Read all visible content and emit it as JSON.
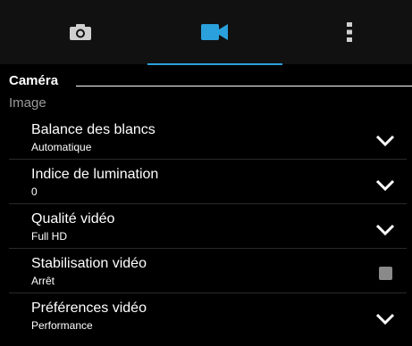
{
  "tabs": [
    {
      "icon": "camera-icon",
      "active": false
    },
    {
      "icon": "video-camera-icon",
      "active": true
    },
    {
      "icon": "more-vert-icon",
      "active": false
    }
  ],
  "colors": {
    "accent": "#2aa0dc",
    "checkbox": "#8a8a8a",
    "muted": "#9a9a9a"
  },
  "section": {
    "title": "Caméra"
  },
  "category": {
    "label": "Image"
  },
  "settings": [
    {
      "title": "Balance des blancs",
      "value": "Automatique",
      "control": "dropdown"
    },
    {
      "title": "Indice de lumination",
      "value": "0",
      "control": "dropdown"
    },
    {
      "title": "Qualité vidéo",
      "value": "Full HD",
      "control": "dropdown"
    },
    {
      "title": "Stabilisation vidéo",
      "value": "Arrêt",
      "control": "checkbox",
      "checked": false
    },
    {
      "title": "Préférences vidéo",
      "value": "Performance",
      "control": "dropdown"
    }
  ]
}
